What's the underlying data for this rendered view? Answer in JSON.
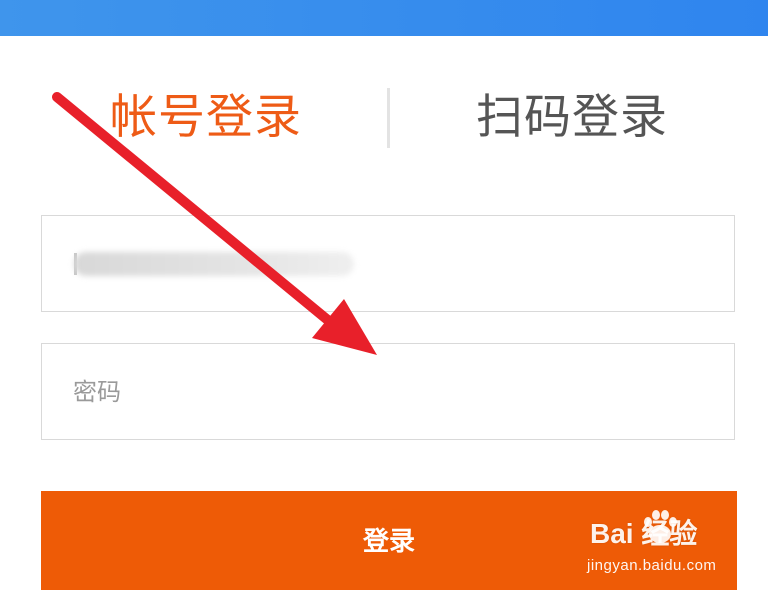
{
  "tabs": {
    "account_login": "帐号登录",
    "qr_login": "扫码登录",
    "active": "account_login"
  },
  "form": {
    "username_value_redacted": true,
    "password_placeholder": "密码",
    "submit_label": "登录"
  },
  "watermark": {
    "logo_text": "Bai 经验",
    "url": "jingyan.baidu.com"
  },
  "annotation": {
    "type": "arrow",
    "color": "#e8202a"
  },
  "colors": {
    "header_blue": "#3a8ff0",
    "accent_orange": "#ee5b06",
    "inactive_tab": "#555555"
  }
}
